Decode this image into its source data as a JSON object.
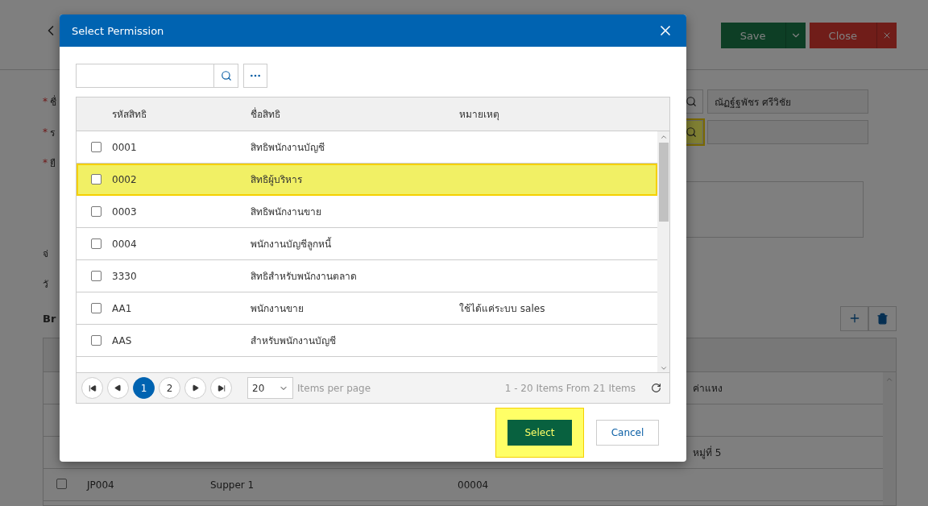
{
  "page": {
    "actions": [
      {
        "kind": "save",
        "label": "Save"
      },
      {
        "kind": "close",
        "label": "Close"
      }
    ],
    "form": [
      {
        "mark": "*",
        "label": "ชื่",
        "lookup": {
          "value": "ณัฏฐ์ฐพัชร ศรีวิชัย",
          "highlighted": false
        }
      },
      {
        "mark": "*",
        "label": "ร",
        "lookup": {
          "highlighted": true
        }
      },
      {
        "mark": "*",
        "label": "ยื"
      },
      {
        "label": "จ่"
      },
      {
        "label": "วั"
      }
    ],
    "section_title": "Br",
    "table": {
      "rows": [
        {
          "col_4": "ค่าแหง"
        },
        {},
        {
          "col_4": "หมู่ที่ 5"
        },
        {
          "checked": false,
          "code": "JP004",
          "name": "Supper 1",
          "col_3": "00004"
        }
      ]
    }
  },
  "dialog": {
    "title": "Select Permission",
    "columns": [
      "รหัสสิทธิ",
      "ชื่อสิทธิ",
      "หมายเหตุ"
    ],
    "rows": [
      {
        "code": "0001",
        "name": "สิทธิพนักงานบัญชี",
        "checked": false,
        "highlighted": false
      },
      {
        "code": "0002",
        "name": "สิทธิผู้บริหาร",
        "checked": false,
        "highlighted": true
      },
      {
        "code": "0003",
        "name": "สิทธิพนักงานขาย",
        "checked": false,
        "highlighted": false
      },
      {
        "code": "0004",
        "name": "พนักงานบัญชีลูกหนี้",
        "checked": false,
        "highlighted": false
      },
      {
        "code": "3330",
        "name": "สิทธิสำหรับพนักงานตลาด",
        "checked": false,
        "highlighted": false
      },
      {
        "code": "AA1",
        "name": "พนักงานขาย",
        "note": "ใช้ได้แค่ระบบ sales",
        "checked": false,
        "highlighted": false
      },
      {
        "code": "AAS",
        "name": "สำหรับพนักงานบัญชี",
        "checked": false,
        "highlighted": false
      }
    ],
    "pages": [
      {
        "label": "1",
        "selected": true
      },
      {
        "label": "2",
        "selected": false
      }
    ],
    "page_size": "20",
    "per_page_label": "Items per page",
    "summary": "1 - 20 Items From 21 Items",
    "buttons": [
      {
        "kind": "primary",
        "label": "Select",
        "highlighted": true
      },
      {
        "kind": "secondary",
        "label": "Cancel",
        "highlighted": false
      }
    ]
  }
}
